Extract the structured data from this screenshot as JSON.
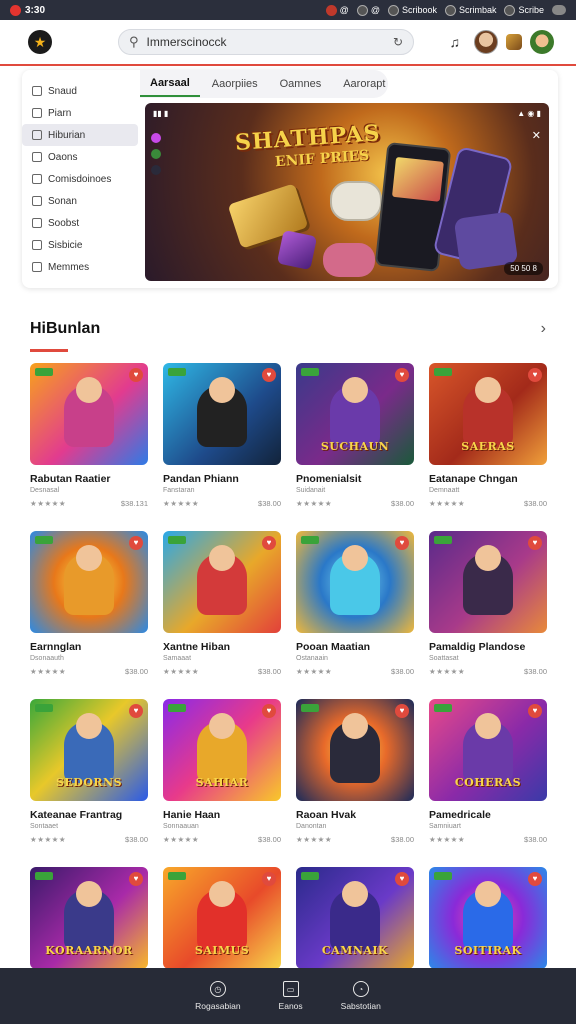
{
  "status_bar": {
    "time": "3:30",
    "chips": [
      {
        "icon": "record-icon",
        "label": "@"
      },
      {
        "icon": "globe-icon",
        "label": "@"
      },
      {
        "icon": "sync-icon",
        "label": "Scribook"
      },
      {
        "icon": "shield-icon",
        "label": "Scrimbak"
      },
      {
        "icon": "antenna-icon",
        "label": "Scribe"
      }
    ]
  },
  "header": {
    "logo_icon": "star-icon",
    "search": {
      "value": "Immerscinocck",
      "placeholder": "Search"
    },
    "bell_icon": "bell-icon"
  },
  "sidebar": {
    "items": [
      {
        "label": "Snaud",
        "icon": "home-icon",
        "active": false
      },
      {
        "label": "Piarn",
        "icon": "grid-icon",
        "active": false
      },
      {
        "label": "Hiburian",
        "icon": "search-icon",
        "active": true
      },
      {
        "label": "Oaons",
        "icon": "chat-icon",
        "active": false
      },
      {
        "label": "Comisdoinoes",
        "icon": "puzzle-icon",
        "active": false
      },
      {
        "label": "Sonan",
        "icon": "book-icon",
        "active": false
      },
      {
        "label": "Soobst",
        "icon": "box-icon",
        "active": false
      },
      {
        "label": "Sisbicie",
        "icon": "layers-icon",
        "active": false
      },
      {
        "label": "Memmes",
        "icon": "image-icon",
        "active": false
      }
    ]
  },
  "tabs": [
    {
      "label": "Aarsaal",
      "active": true
    },
    {
      "label": "Aaorpiies",
      "active": false
    },
    {
      "label": "Oamnes",
      "active": false
    },
    {
      "label": "Aarorapt",
      "active": false
    }
  ],
  "banner": {
    "title": "SHATHPAS",
    "subtitle": "ENIF PRIES",
    "badge": "50 50 8"
  },
  "section": {
    "title": "HiBunlan",
    "arrow_icon": "chevron-right-icon"
  },
  "games": [
    {
      "title": "Rabutan Raatier",
      "sub": "Desnasal",
      "rating": "★★★★★",
      "price": "$38.131",
      "wordart": "",
      "bg": "linear-gradient(135deg,#f7a21c,#e23b8f 55%,#2e7be6)",
      "fig": "#c8408a"
    },
    {
      "title": "Pandan Phiann",
      "sub": "Fanstaran",
      "rating": "★★★★★",
      "price": "$38.00",
      "wordart": "",
      "bg": "linear-gradient(135deg,#2fb8e6,#1e4a8a 60%,#12233a)",
      "fig": "#222"
    },
    {
      "title": "Pnomenialsit",
      "sub": "Suidanait",
      "rating": "★★★★★",
      "price": "$38.00",
      "wordart": "SUCHAUN",
      "bg": "linear-gradient(135deg,#3a3a8a,#7a2a8a 55%,#1a5a3a)",
      "fig": "#6a3aaa"
    },
    {
      "title": "Eatanape Chngan",
      "sub": "Demnaatt",
      "rating": "★★★★★",
      "price": "$38.00",
      "wordart": "SAERAS",
      "bg": "linear-gradient(135deg,#d8562a,#a32a1a 55%,#f0a03a)",
      "fig": "#b8322a"
    },
    {
      "title": "Earnnglan",
      "sub": "Dsonaauth",
      "rating": "★★★★★",
      "price": "$38.00",
      "wordart": "",
      "bg": "radial-gradient(circle,#f8e24a,#e8781a 45%,#2a8ae6)",
      "fig": "#e89a2a"
    },
    {
      "title": "Xantne Hiban",
      "sub": "Samaaat",
      "rating": "★★★★★",
      "price": "$38.00",
      "wordart": "",
      "bg": "linear-gradient(135deg,#2aa8e8,#e8a82a 55%,#e2403a)",
      "fig": "#d33a3a"
    },
    {
      "title": "Pooan Maatian",
      "sub": "Ostanaain",
      "rating": "★★★★★",
      "price": "$38.00",
      "wordart": "",
      "bg": "radial-gradient(circle,#7ad8f0,#2a78c8 45%,#f0b83a)",
      "fig": "#4ac8e8"
    },
    {
      "title": "Pamaldig Plandose",
      "sub": "Soattasat",
      "rating": "★★★★★",
      "price": "$38.00",
      "wordart": "",
      "bg": "linear-gradient(135deg,#5a2a8a,#a83a8a 55%,#e88a3a)",
      "fig": "#3a2a4a"
    },
    {
      "title": "Kateanae Frantrag",
      "sub": "Sontaaet",
      "rating": "★★★★★",
      "price": "$38.00",
      "wordart": "SEDORNS",
      "bg": "linear-gradient(135deg,#3aa83a,#e8c82a 45%,#2a5ae8)",
      "fig": "#3a6ab8"
    },
    {
      "title": "Hanie Haan",
      "sub": "Sonnaauan",
      "rating": "★★★★★",
      "price": "$38.00",
      "wordart": "SAHIAR",
      "bg": "linear-gradient(135deg,#8a2ae8,#e83a8a 50%,#f8c82a)",
      "fig": "#e8a82a"
    },
    {
      "title": "Raoan Hvak",
      "sub": "Danontan",
      "rating": "★★★★★",
      "price": "$38.00",
      "wordart": "",
      "bg": "radial-gradient(circle,#f8d84a,#e86a2a 40%,#1a2a5a)",
      "fig": "#2a2a3a"
    },
    {
      "title": "Pamedricale",
      "sub": "Samniuart",
      "rating": "★★★★★",
      "price": "$38.00",
      "wordart": "COHERAS",
      "bg": "linear-gradient(135deg,#e84a8a,#8a2aa8 55%,#3a3aa8)",
      "fig": "#6a3aa8"
    },
    {
      "title": "",
      "sub": "",
      "rating": "",
      "price": "",
      "wordart": "KORAARNOR",
      "bg": "linear-gradient(135deg,#3a1a6a,#a82aa8 55%,#f8b82a)",
      "fig": "#3a3a8a"
    },
    {
      "title": "",
      "sub": "",
      "rating": "",
      "price": "",
      "wordart": "SAIMUS",
      "bg": "linear-gradient(135deg,#f8a82a,#e84a2a 55%,#f8d84a)",
      "fig": "#e2302a"
    },
    {
      "title": "",
      "sub": "",
      "rating": "",
      "price": "",
      "wordart": "CAMNAIK",
      "bg": "linear-gradient(135deg,#2a2a8a,#6a3ac8 55%,#e8a82a)",
      "fig": "#3a2a8a"
    },
    {
      "title": "",
      "sub": "",
      "rating": "",
      "price": "",
      "wordart": "SOITIRAK",
      "bg": "radial-gradient(circle,#f84aa8,#8a2ad8 45%,#2a8ae8)",
      "fig": "#2a6ae8"
    }
  ],
  "bottom_nav": [
    {
      "label": "Rogasabian",
      "icon": "clock-icon"
    },
    {
      "label": "Eanos",
      "icon": "window-icon"
    },
    {
      "label": "Sabstotian",
      "icon": "compass-icon"
    }
  ]
}
